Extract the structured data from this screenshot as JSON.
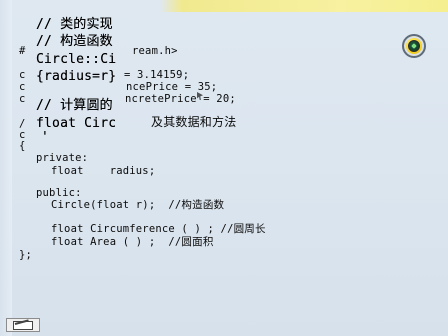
{
  "slide": {
    "overlay": {
      "line1": "// 类的实现",
      "line2": "// 构造函数",
      "line3": "Circle::Ci",
      "line4": "{radius=r}",
      "line5": "// 计算圆的",
      "line6": "float Circ",
      "line7": "'"
    },
    "code": {
      "header": "#",
      "include_tail": "ream.h>",
      "const1_prefix": "c",
      "const1_tail": "= 3.14159;",
      "const2_prefix": "c",
      "const2_tail": "ncePrice = 35;",
      "const3_prefix": "c",
      "const3_tail": "ncretePrice = 20;",
      "class_note": "及其数据和方法",
      "slash_line": "/",
      "class_line": "c",
      "open_brace": "{",
      "private": "private:",
      "float_radius": "float    radius;",
      "public": "public:",
      "ctor": "Circle(float r);  //构造函数",
      "circumference": "float Circumference ( ) ; //圆周长",
      "area": "float Area ( ) ;  //圆面积",
      "close": "};"
    },
    "icons": {
      "emblem": "windows-emblem-icon",
      "tool": "tool-icon"
    },
    "colors": {
      "background": "#dce6ef",
      "banner": "#f6ef8f",
      "text": "#000000"
    }
  }
}
